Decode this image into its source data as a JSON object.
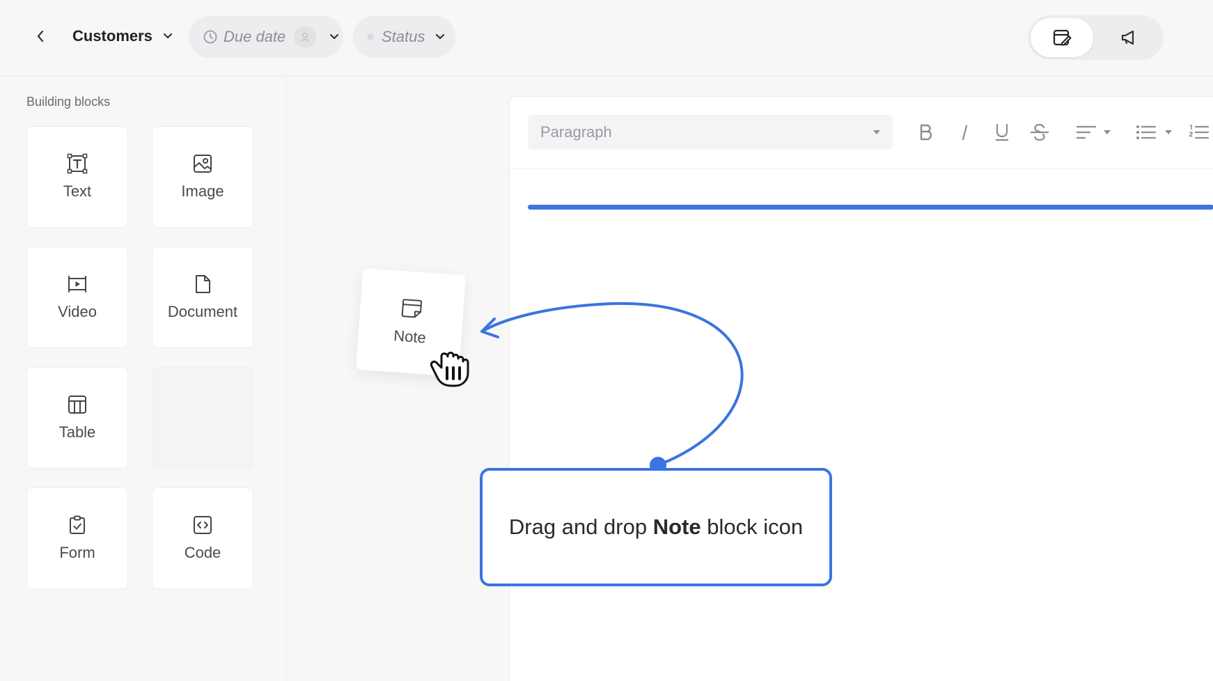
{
  "header": {
    "back_icon": "chevron-left-icon",
    "breadcrumb_label": "Customers",
    "filters": [
      {
        "label": "Due date",
        "icon": "clock-icon"
      },
      {
        "label": "Status"
      }
    ],
    "view_toggle": [
      {
        "icon": "edit-document-icon",
        "active": true
      },
      {
        "icon": "megaphone-icon",
        "active": false
      }
    ]
  },
  "sidebar": {
    "title": "Building blocks",
    "blocks": [
      {
        "label": "Text",
        "icon": "text-box-icon"
      },
      {
        "label": "Image",
        "icon": "image-icon"
      },
      {
        "label": "Video",
        "icon": "video-icon"
      },
      {
        "label": "Document",
        "icon": "document-icon"
      },
      {
        "label": "Table",
        "icon": "table-icon"
      },
      {
        "label": "",
        "icon": ""
      },
      {
        "label": "Form",
        "icon": "clipboard-check-icon"
      },
      {
        "label": "Code",
        "icon": "code-icon"
      }
    ]
  },
  "editor": {
    "paragraph_select": "Paragraph",
    "toolbar_items": [
      "bold-icon",
      "italic-icon",
      "underline-icon",
      "strikethrough-icon",
      "align-icon",
      "bullet-list-icon",
      "numbered-list-icon"
    ]
  },
  "drag": {
    "label": "Note",
    "icon": "note-icon"
  },
  "callout": {
    "prefix": "Drag and drop ",
    "bold": "Note",
    "suffix": " block icon"
  },
  "colors": {
    "accent": "#3b74e0",
    "background": "#f7f7f8",
    "surface": "#ffffff"
  }
}
